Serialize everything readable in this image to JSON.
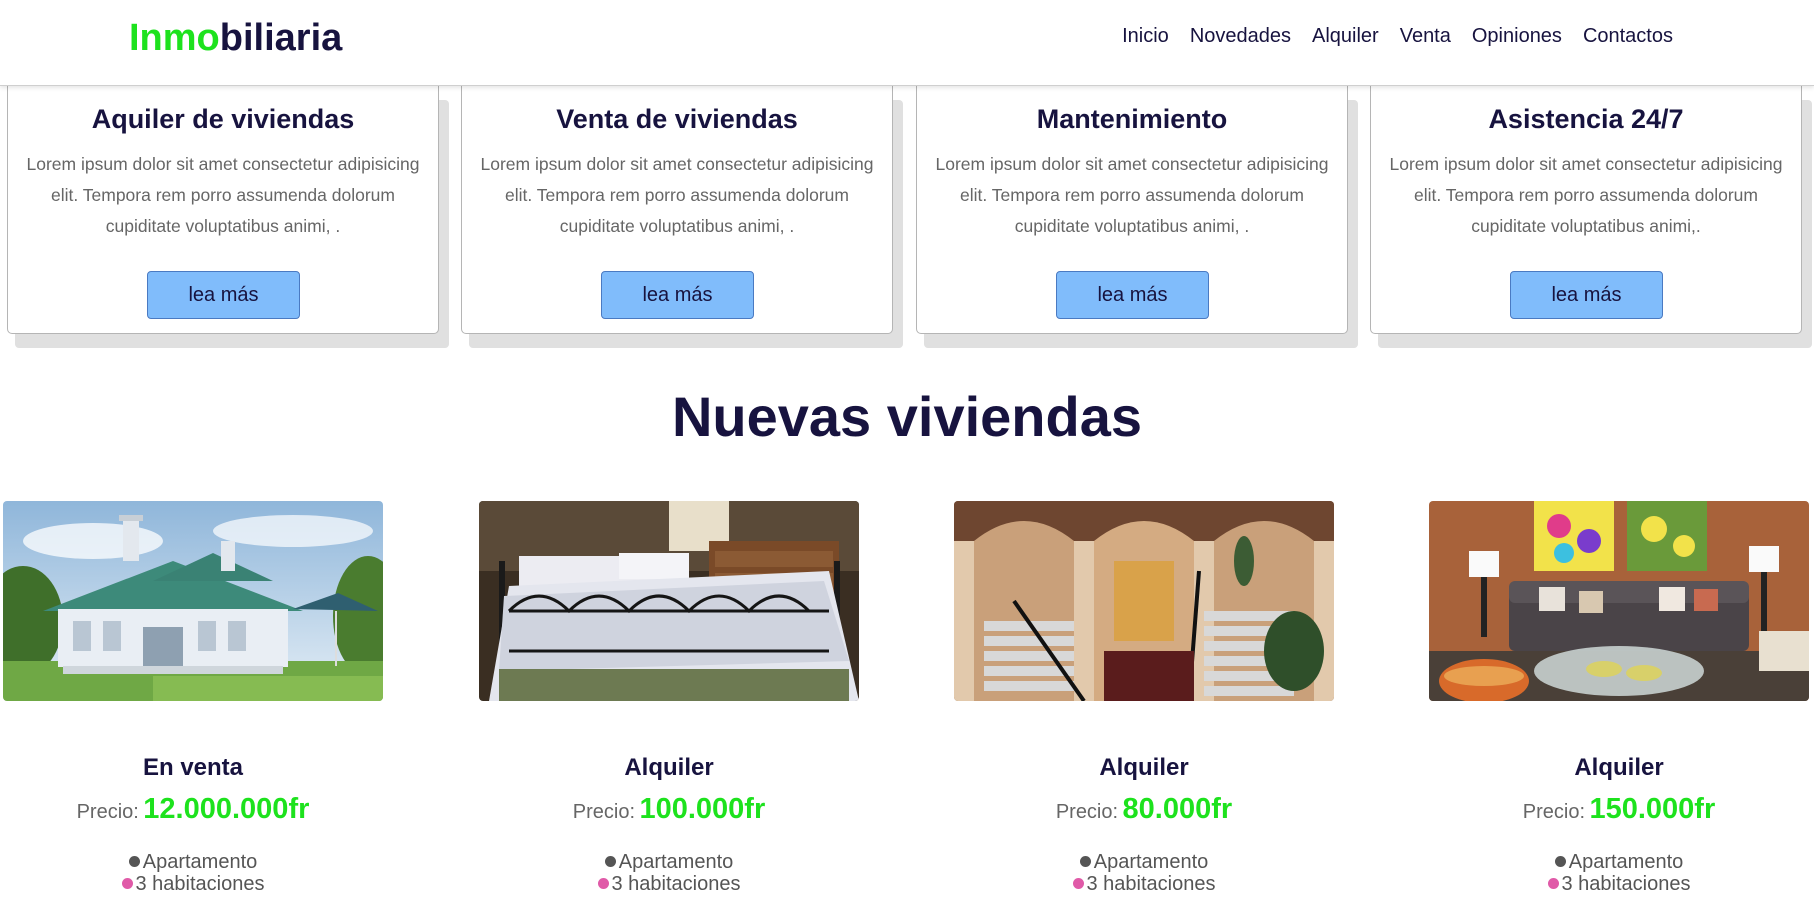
{
  "brand": {
    "logo_part1": "Inmo",
    "logo_part2": "biliaria",
    "accent_color": "#1de21d",
    "primary_color": "#17133f"
  },
  "nav": {
    "items": [
      "Inicio",
      "Novedades",
      "Alquiler",
      "Venta",
      "Opiniones",
      "Contactos"
    ]
  },
  "services": [
    {
      "title": "Aquiler de viviendas",
      "text": "Lorem ipsum dolor sit amet consectetur adipisicing elit. Tempora rem porro assumenda dolorum cupiditate voluptatibus animi, .",
      "button": "lea más"
    },
    {
      "title": "Venta de viviendas",
      "text": "Lorem ipsum dolor sit amet consectetur adipisicing elit. Tempora rem porro assumenda dolorum cupiditate voluptatibus animi, .",
      "button": "lea más"
    },
    {
      "title": "Mantenimiento",
      "text": "Lorem ipsum dolor sit amet consectetur adipisicing elit. Tempora rem porro assumenda dolorum cupiditate voluptatibus animi, .",
      "button": "lea más"
    },
    {
      "title": "Asistencia 24/7",
      "text": "Lorem ipsum dolor sit amet consectetur adipisicing elit. Tempora rem porro assumenda dolorum cupiditate voluptatibus animi,.",
      "button": "lea más"
    }
  ],
  "new_homes": {
    "title": "Nuevas viviendas",
    "properties": [
      {
        "image": "house-exterior-photo",
        "status": "En venta",
        "price_label": "Precio:",
        "price": "12.000.000fr",
        "features": [
          "Apartamento",
          "3 habitaciones"
        ]
      },
      {
        "image": "bedroom-photo",
        "status": "Alquiler",
        "price_label": "Precio:",
        "price": "100.000fr",
        "features": [
          "Apartamento",
          "3 habitaciones"
        ]
      },
      {
        "image": "stairway-photo",
        "status": "Alquiler",
        "price_label": "Precio:",
        "price": "80.000fr",
        "features": [
          "Apartamento",
          "3 habitaciones"
        ]
      },
      {
        "image": "living-room-photo",
        "status": "Alquiler",
        "price_label": "Precio:",
        "price": "150.000fr",
        "features": [
          "Apartamento",
          "3 habitaciones"
        ]
      }
    ],
    "bullet_colors": [
      "#555555",
      "#e05aa8"
    ]
  }
}
